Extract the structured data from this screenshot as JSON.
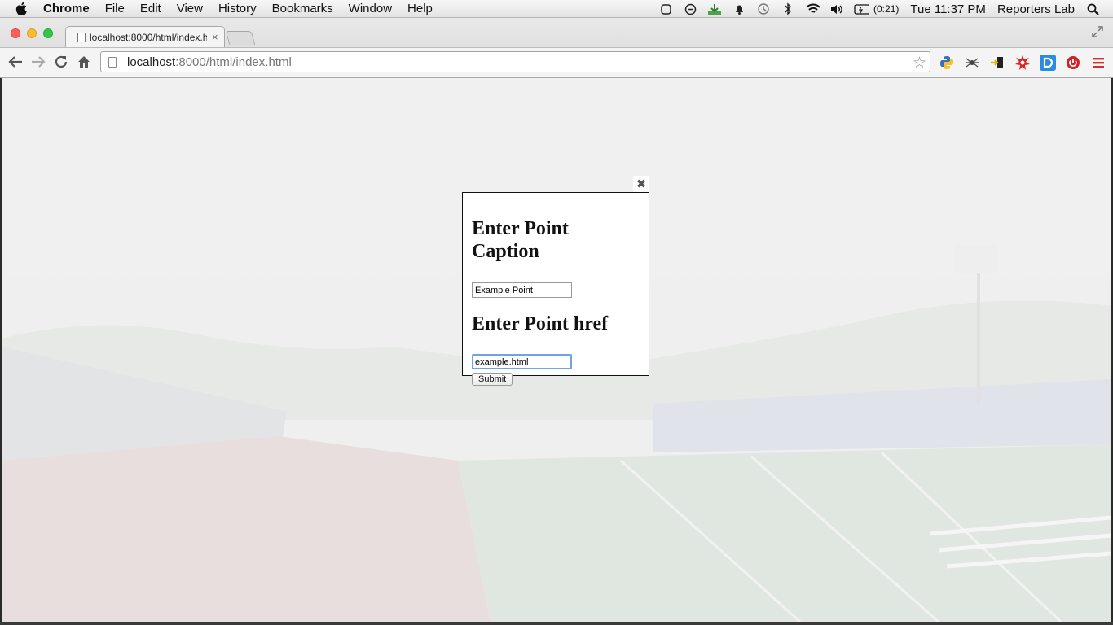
{
  "menubar": {
    "app_name": "Chrome",
    "menus": [
      "File",
      "Edit",
      "View",
      "History",
      "Bookmarks",
      "Window",
      "Help"
    ],
    "battery_time": "(0:21)",
    "clock": "Tue 11:37 PM",
    "user": "Reporters Lab"
  },
  "browser": {
    "tab_title": "localhost:8000/html/index.html",
    "tab_close": "×",
    "url_host": "localhost",
    "url_rest": ":8000/html/index.html"
  },
  "popup": {
    "caption_heading": "Enter Point Caption",
    "caption_value": "Example Point",
    "href_heading": "Enter Point href",
    "href_value": "example.html",
    "submit_label": "Submit",
    "close_symbol": "✖"
  }
}
